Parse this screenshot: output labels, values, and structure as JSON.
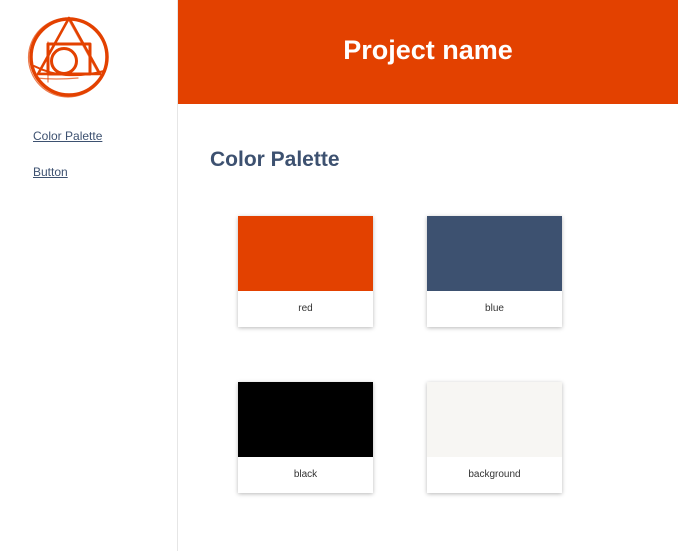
{
  "colors": {
    "accent": "#e34100",
    "navy": "#3d5170",
    "sidebar_border": "#e6e6e6"
  },
  "sidebar": {
    "logo_icon": "circle-triangle-square-logo",
    "items": [
      {
        "label": "Color Palette"
      },
      {
        "label": "Button"
      }
    ]
  },
  "header": {
    "title": "Project name"
  },
  "main": {
    "section_title": "Color Palette",
    "swatches": [
      {
        "name": "red",
        "color": "#e34100"
      },
      {
        "name": "blue",
        "color": "#3d5170"
      },
      {
        "name": "black",
        "color": "#000000"
      },
      {
        "name": "background",
        "color": "#f7f6f3"
      }
    ]
  }
}
